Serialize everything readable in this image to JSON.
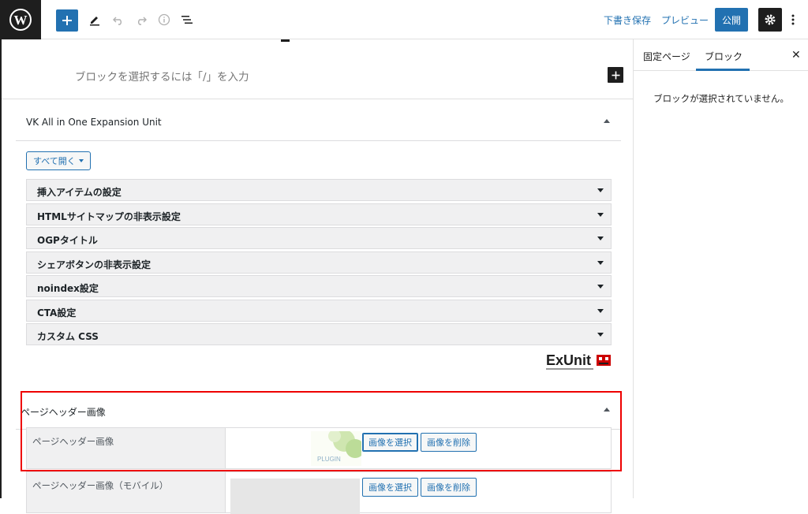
{
  "toolbar": {
    "draft_label": "下書き保存",
    "preview_label": "プレビュー",
    "publish_label": "公開"
  },
  "editor": {
    "block_placeholder": "ブロックを選択するには「/」を入力"
  },
  "meta_box": {
    "title": "VK All in One Expansion Unit",
    "expand_all_label": "すべて開く",
    "accordion": [
      {
        "label": "挿入アイテムの設定"
      },
      {
        "label": "HTMLサイトマップの非表示設定"
      },
      {
        "label": "OGPタイトル"
      },
      {
        "label": "シェアボタンの非表示設定"
      },
      {
        "label": "noindex設定"
      },
      {
        "label": "CTA設定"
      },
      {
        "label": "カスタム CSS"
      }
    ],
    "logo_text": "ExUnit"
  },
  "header_image_box": {
    "title": "ページヘッダー画像",
    "rows": [
      {
        "label": "ページヘッダー画像",
        "select_label": "画像を選択",
        "remove_label": "画像を削除",
        "thumb_text": "PLUGIN"
      },
      {
        "label": "ページヘッダー画像（モバイル）",
        "select_label": "画像を選択",
        "remove_label": "画像を削除"
      }
    ]
  },
  "sidebar": {
    "tab_page": "固定ページ",
    "tab_block": "ブロック",
    "empty_message": "ブロックが選択されていません。"
  },
  "colors": {
    "accent": "#2271b1",
    "highlight": "#ee0000",
    "dark": "#1e1e1e"
  }
}
